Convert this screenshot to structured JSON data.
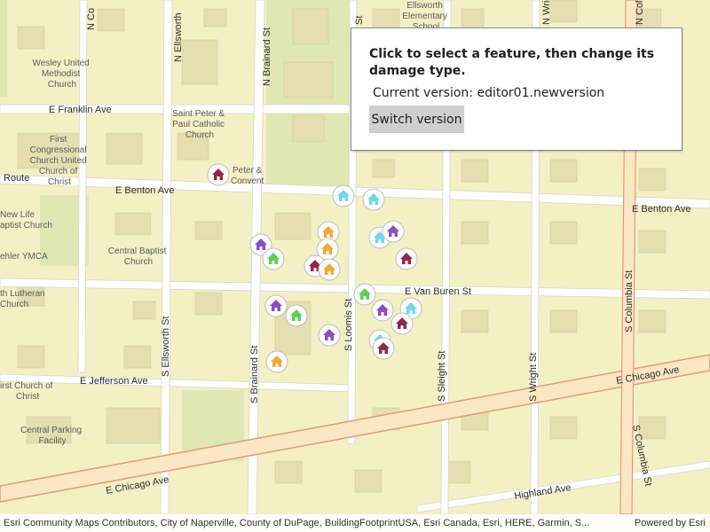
{
  "panel": {
    "title": "Click to select a feature, then change its damage type.",
    "version_label": "Current version: editor01.newversion",
    "switch_button": "Switch version"
  },
  "attribution": {
    "text": "Esri Community Maps Contributors, City of Naperville, County of DuPage, BuildingFootprintUSA, Esri Canada, Esri, HERE, Garmin, S...",
    "powered": "Powered by Esri"
  },
  "map": {
    "streets": {
      "franklin": "E Franklin Ave",
      "benton_w": "E Benton Ave",
      "benton_e": "E Benton Ave",
      "van_buren": "E Van Buren St",
      "jefferson": "E Jefferson Ave",
      "chicago_w": "E Chicago Ave",
      "chicago_e": "E Chicago Ave",
      "highland": "Highland Ave",
      "brainard_n": "N Brainard St",
      "brainard_s": "S Brainard St",
      "loomis_s": "S Loomis St",
      "loomis_n": "St",
      "ellsworth_s": "S Ellsworth St",
      "ellsworth_n": "N Ellsworth",
      "sleight": "S Sleight St",
      "wright_s": "S Wright St",
      "wright_n": "N Wright",
      "columbia_s": "S Columbia St",
      "columbia_s2": "S Columbia St",
      "columbia_n": "N Col",
      "n_col2": "N Co",
      "route": "Route"
    },
    "places": {
      "wesley": [
        "Wesley United",
        "Methodist",
        "Church"
      ],
      "stpeter": [
        "Saint Peter &",
        "Paul Catholic",
        "Church"
      ],
      "first_congregational": [
        "First",
        "Congressional",
        "Church United",
        "Church of",
        "Christ"
      ],
      "peter_convent": [
        "Peter &",
        "Convent"
      ],
      "new_life": [
        "New Life",
        "aptist Church"
      ],
      "ymca": [
        "ehler YMCA"
      ],
      "central_baptist": [
        "Central Baptist",
        "Church"
      ],
      "lutheran": [
        "th Lutheran",
        "Church"
      ],
      "first_church_christ": [
        "irst Church of",
        "Christ"
      ],
      "central_parking": [
        "Central Parking",
        "Facility"
      ],
      "ellsworth_elem": [
        "Ellsworth",
        "Elementary",
        "School"
      ]
    },
    "symbol_colors": {
      "purple": "#8b4cc4",
      "maroon": "#8e2a47",
      "cyan": "#6fd8ee",
      "green": "#5bd255",
      "orange": "#f0a93a"
    },
    "features": [
      {
        "color": "maroon"
      },
      {
        "color": "cyan"
      },
      {
        "color": "cyan"
      },
      {
        "color": "purple"
      },
      {
        "color": "green"
      },
      {
        "color": "orange"
      },
      {
        "color": "orange"
      },
      {
        "color": "maroon"
      },
      {
        "color": "orange"
      },
      {
        "color": "cyan"
      },
      {
        "color": "purple"
      },
      {
        "color": "maroon"
      },
      {
        "color": "green"
      },
      {
        "color": "purple"
      },
      {
        "color": "green"
      },
      {
        "color": "purple"
      },
      {
        "color": "cyan"
      },
      {
        "color": "maroon"
      },
      {
        "color": "purple"
      },
      {
        "color": "cyan"
      },
      {
        "color": "maroon"
      },
      {
        "color": "orange"
      }
    ]
  }
}
